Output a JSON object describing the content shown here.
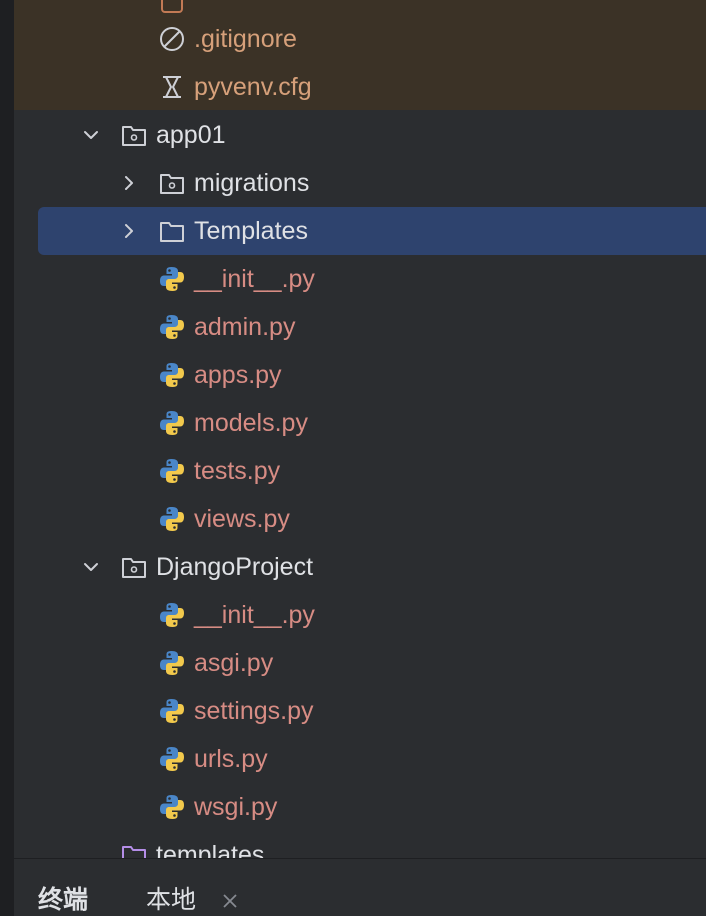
{
  "tree": {
    "excluded": [
      {
        "label": ".gitignore",
        "icon": "ignore-file-icon"
      },
      {
        "label": "pyvenv.cfg",
        "icon": "config-file-icon"
      }
    ],
    "app01": {
      "label": "app01",
      "children": [
        {
          "label": "migrations",
          "icon": "package-folder-icon"
        },
        {
          "label": "Templates",
          "icon": "folder-icon"
        },
        {
          "label": "__init__.py",
          "icon": "python-file-icon"
        },
        {
          "label": "admin.py",
          "icon": "python-file-icon"
        },
        {
          "label": "apps.py",
          "icon": "python-file-icon"
        },
        {
          "label": "models.py",
          "icon": "python-file-icon"
        },
        {
          "label": "tests.py",
          "icon": "python-file-icon"
        },
        {
          "label": "views.py",
          "icon": "python-file-icon"
        }
      ]
    },
    "project": {
      "label": "DjangoProject",
      "children": [
        {
          "label": "__init__.py",
          "icon": "python-file-icon"
        },
        {
          "label": "asgi.py",
          "icon": "python-file-icon"
        },
        {
          "label": "settings.py",
          "icon": "python-file-icon"
        },
        {
          "label": "urls.py",
          "icon": "python-file-icon"
        },
        {
          "label": "wsgi.py",
          "icon": "python-file-icon"
        }
      ]
    },
    "templates": {
      "label": "templates",
      "icon": "templates-folder-icon"
    },
    "selected": "Templates"
  },
  "bottom_tabs": [
    "终端",
    "本地"
  ],
  "colors": {
    "panel": "#2b2d30",
    "excluded_bg": "#3b3226",
    "selection": "#2e436e",
    "python_file_text": "#d78c84",
    "excluded_text": "#d6a07a",
    "default_text": "#dfe1e5",
    "python_blue": "#4a86c8",
    "python_yellow": "#f2c94c"
  }
}
